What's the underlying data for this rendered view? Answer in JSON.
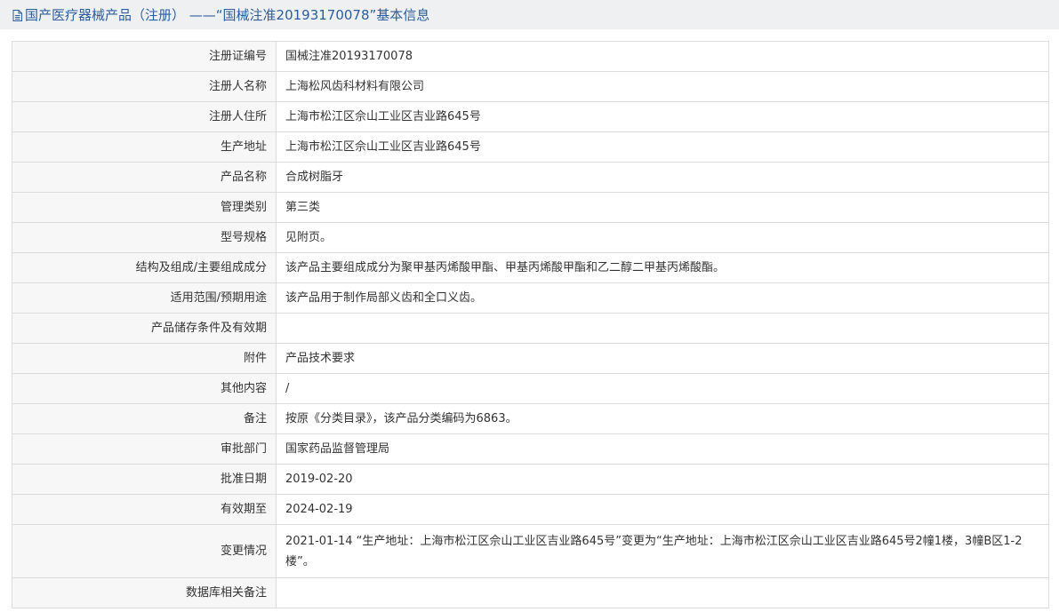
{
  "header": {
    "title": "国产医疗器械产品（注册） ——“国械注准20193170078”基本信息"
  },
  "rows": [
    {
      "label": "注册证编号",
      "value": "国械注准20193170078"
    },
    {
      "label": "注册人名称",
      "value": "上海松风齿科材料有限公司"
    },
    {
      "label": "注册人住所",
      "value": "上海市松江区佘山工业区吉业路645号"
    },
    {
      "label": "生产地址",
      "value": "上海市松江区佘山工业区吉业路645号"
    },
    {
      "label": "产品名称",
      "value": "合成树脂牙"
    },
    {
      "label": "管理类别",
      "value": "第三类"
    },
    {
      "label": "型号规格",
      "value": "见附页。"
    },
    {
      "label": "结构及组成/主要组成成分",
      "value": "该产品主要组成成分为聚甲基丙烯酸甲酯、甲基丙烯酸甲酯和乙二醇二甲基丙烯酸酯。"
    },
    {
      "label": "适用范围/预期用途",
      "value": "该产品用于制作局部义齿和全口义齿。"
    },
    {
      "label": "产品储存条件及有效期",
      "value": ""
    },
    {
      "label": "附件",
      "value": "产品技术要求"
    },
    {
      "label": "其他内容",
      "value": "/"
    },
    {
      "label": "备注",
      "value": "按原《分类目录》，该产品分类编码为6863。"
    },
    {
      "label": "审批部门",
      "value": "国家药品监督管理局"
    },
    {
      "label": "批准日期",
      "value": "2019-02-20"
    },
    {
      "label": "有效期至",
      "value": "2024-02-19"
    },
    {
      "label": "变更情况",
      "value": "2021-01-14 “生产地址：上海市松江区佘山工业区吉业路645号”变更为“生产地址：上海市松江区佘山工业区吉业路645号2幢1楼，3幢B区1-2楼”。"
    },
    {
      "label": "数据库相关备注",
      "value": ""
    }
  ],
  "colors": {
    "title_text": "#2c5d9a",
    "title_bg": "#eef0f2",
    "label_bg": "#f7f7f7",
    "border": "#dcdcdc"
  },
  "icons": {
    "title_icon": "document-icon"
  }
}
